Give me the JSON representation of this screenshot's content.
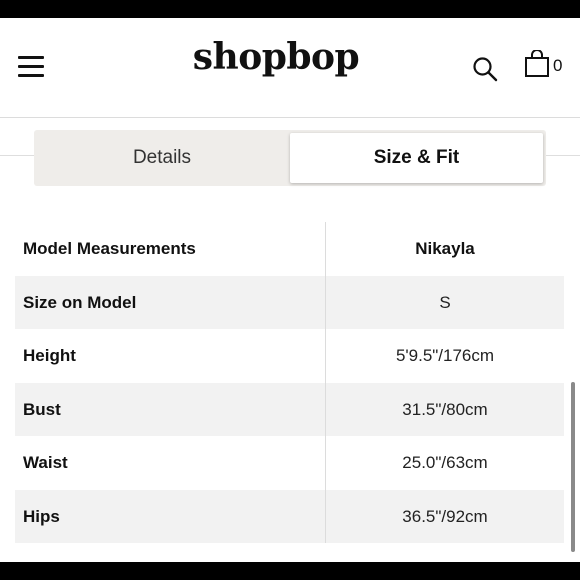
{
  "header": {
    "logo": "shopbop",
    "bag_count": "0"
  },
  "tabs": [
    {
      "label": "Details",
      "selected": false
    },
    {
      "label": "Size & Fit",
      "selected": true
    }
  ],
  "table": {
    "rows": [
      {
        "label": "Model Measurements",
        "value": "Nikayla"
      },
      {
        "label": "Size on Model",
        "value": "S"
      },
      {
        "label": "Height",
        "value": "5'9.5\"/176cm"
      },
      {
        "label": "Bust",
        "value": "31.5\"/80cm"
      },
      {
        "label": "Waist",
        "value": "25.0\"/63cm"
      },
      {
        "label": "Hips",
        "value": "36.5\"/92cm"
      }
    ]
  },
  "icons": {
    "menu": "hamburger-menu-icon",
    "search": "search-icon",
    "bag": "shopping-bag-icon"
  }
}
